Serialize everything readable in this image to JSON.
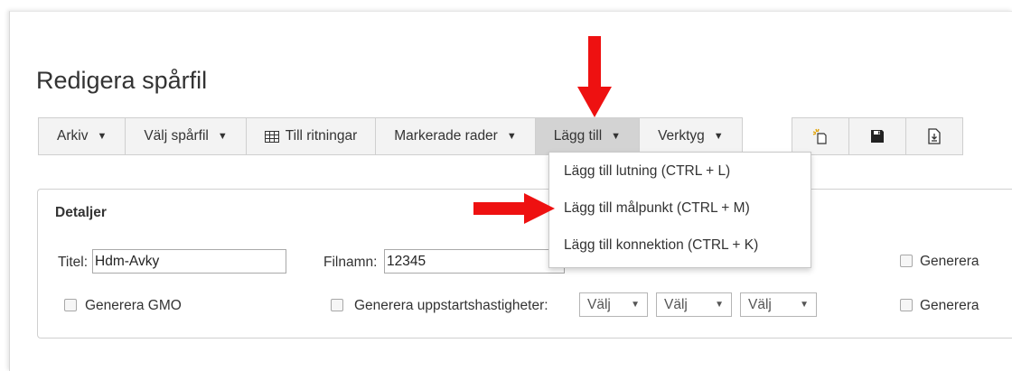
{
  "page": {
    "title": "Redigera spårfil"
  },
  "toolbar": {
    "arkiv": "Arkiv",
    "valj_sparfil": "Välj spårfil",
    "till_ritningar": "Till ritningar",
    "markerade_rader": "Markerade rader",
    "lagg_till": "Lägg till",
    "verktyg": "Verktyg",
    "caret": "▼"
  },
  "icons": {
    "new": "new-file-icon",
    "save": "save-icon",
    "export": "export-file-icon",
    "table": "table-icon"
  },
  "dropdown": {
    "items": [
      "Lägg till lutning (CTRL + L)",
      "Lägg till målpunkt (CTRL + M)",
      "Lägg till konnektion (CTRL + K)"
    ]
  },
  "details": {
    "title": "Detaljer",
    "titel_label": "Titel:",
    "titel_value": "Hdm-Avky",
    "filnamn_label": "Filnamn:",
    "filnamn_value": "12345",
    "generera_1": "Generera",
    "generera_gmo": "Generera GMO",
    "generera_uppstart": "Generera uppstartshastigheter:",
    "select_1": "Välj",
    "select_2": "Välj",
    "select_3": "Välj",
    "generera_2": "Generera"
  },
  "colors": {
    "annotation_arrow": "#ee1111",
    "active_menu": "#d3d3d3",
    "toolbar_bg": "#f3f3f3"
  }
}
